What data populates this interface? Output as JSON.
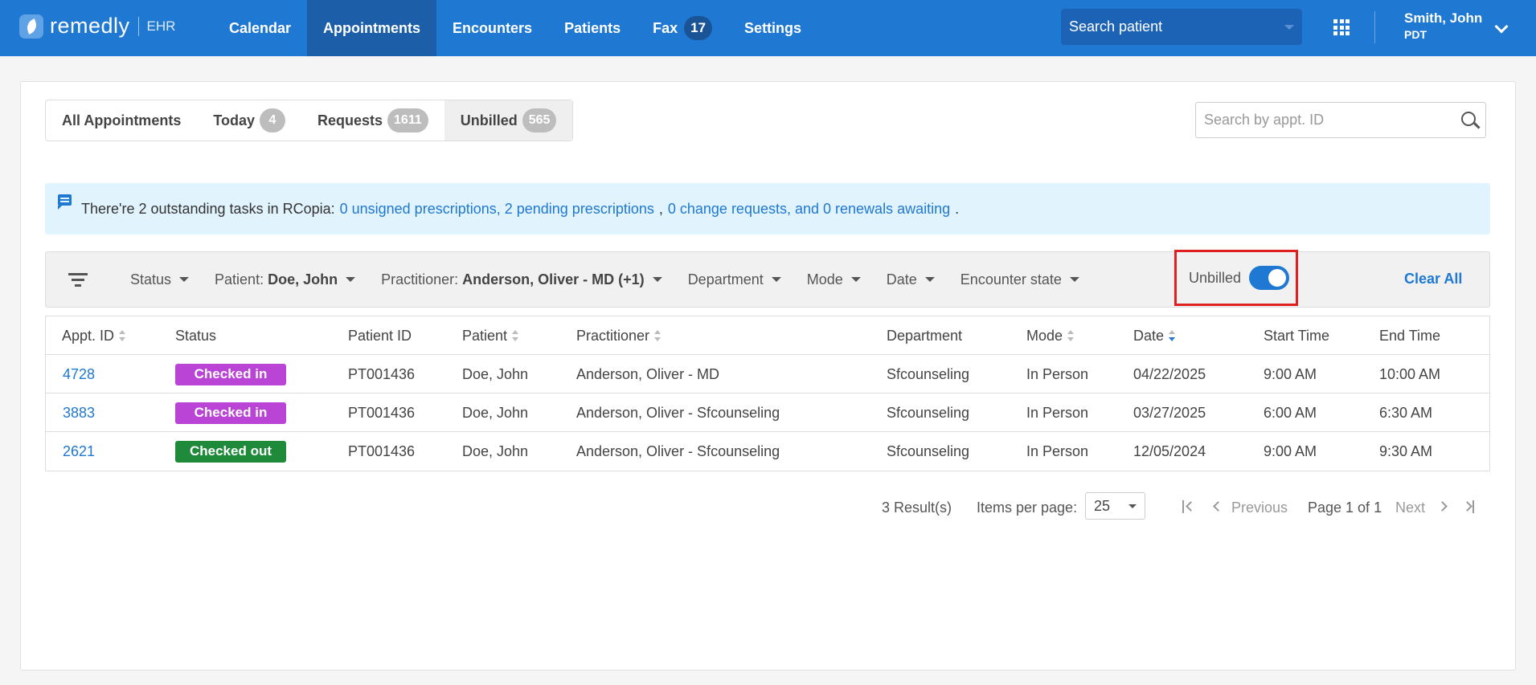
{
  "brand": {
    "name": "remedly",
    "product": "EHR"
  },
  "nav": {
    "items": [
      {
        "label": "Calendar"
      },
      {
        "label": "Appointments",
        "active": true
      },
      {
        "label": "Encounters"
      },
      {
        "label": "Patients"
      },
      {
        "label": "Fax",
        "badge": "17"
      },
      {
        "label": "Settings"
      }
    ],
    "search_placeholder": "Search patient",
    "apps_icon": "grid-icon",
    "user": {
      "name": "Smith, John",
      "timezone": "PDT"
    }
  },
  "tabs": [
    {
      "label": "All Appointments"
    },
    {
      "label": "Today",
      "badge": "4"
    },
    {
      "label": "Requests",
      "badge": "1611"
    },
    {
      "label": "Unbilled",
      "badge": "565",
      "active": true
    }
  ],
  "id_search": {
    "placeholder": "Search by appt. ID"
  },
  "banner": {
    "prefix": "There're 2 outstanding tasks in RCopia:",
    "link1": "0 unsigned prescriptions, 2 pending prescriptions",
    "comma": ",",
    "link2": "0 change requests, and 0 renewals awaiting",
    "suffix": "."
  },
  "filters": {
    "status": "Status",
    "patient_label": "Patient:",
    "patient_value": "Doe, John",
    "practitioner_label": "Practitioner:",
    "practitioner_value": "Anderson, Oliver - MD (+1)",
    "department": "Department",
    "mode": "Mode",
    "date": "Date",
    "encounter_state": "Encounter state",
    "unbilled_label": "Unbilled",
    "unbilled_on": true,
    "clear_all": "Clear All"
  },
  "table": {
    "headers": {
      "appt_id": "Appt. ID",
      "status": "Status",
      "patient_id": "Patient ID",
      "patient": "Patient",
      "practitioner": "Practitioner",
      "department": "Department",
      "mode": "Mode",
      "date": "Date",
      "start_time": "Start Time",
      "end_time": "End Time"
    },
    "rows": [
      {
        "appt_id": "4728",
        "status": "Checked in",
        "status_color": "#b944d6",
        "patient_id": "PT001436",
        "patient": "Doe, John",
        "practitioner": "Anderson, Oliver - MD",
        "department": "Sfcounseling",
        "mode": "In Person",
        "date": "04/22/2025",
        "start_time": "9:00 AM",
        "end_time": "10:00 AM"
      },
      {
        "appt_id": "3883",
        "status": "Checked in",
        "status_color": "#b944d6",
        "patient_id": "PT001436",
        "patient": "Doe, John",
        "practitioner": "Anderson, Oliver - Sfcounseling",
        "department": "Sfcounseling",
        "mode": "In Person",
        "date": "03/27/2025",
        "start_time": "6:00 AM",
        "end_time": "6:30 AM"
      },
      {
        "appt_id": "2621",
        "status": "Checked out",
        "status_color": "#1e8a3a",
        "patient_id": "PT001436",
        "patient": "Doe, John",
        "practitioner": "Anderson, Oliver - Sfcounseling",
        "department": "Sfcounseling",
        "mode": "In Person",
        "date": "12/05/2024",
        "start_time": "9:00 AM",
        "end_time": "9:30 AM"
      }
    ]
  },
  "pagination": {
    "results": "3 Result(s)",
    "items_per_page_label": "Items per page:",
    "items_per_page": "25",
    "previous": "Previous",
    "page_info": "Page 1 of 1",
    "next": "Next"
  }
}
